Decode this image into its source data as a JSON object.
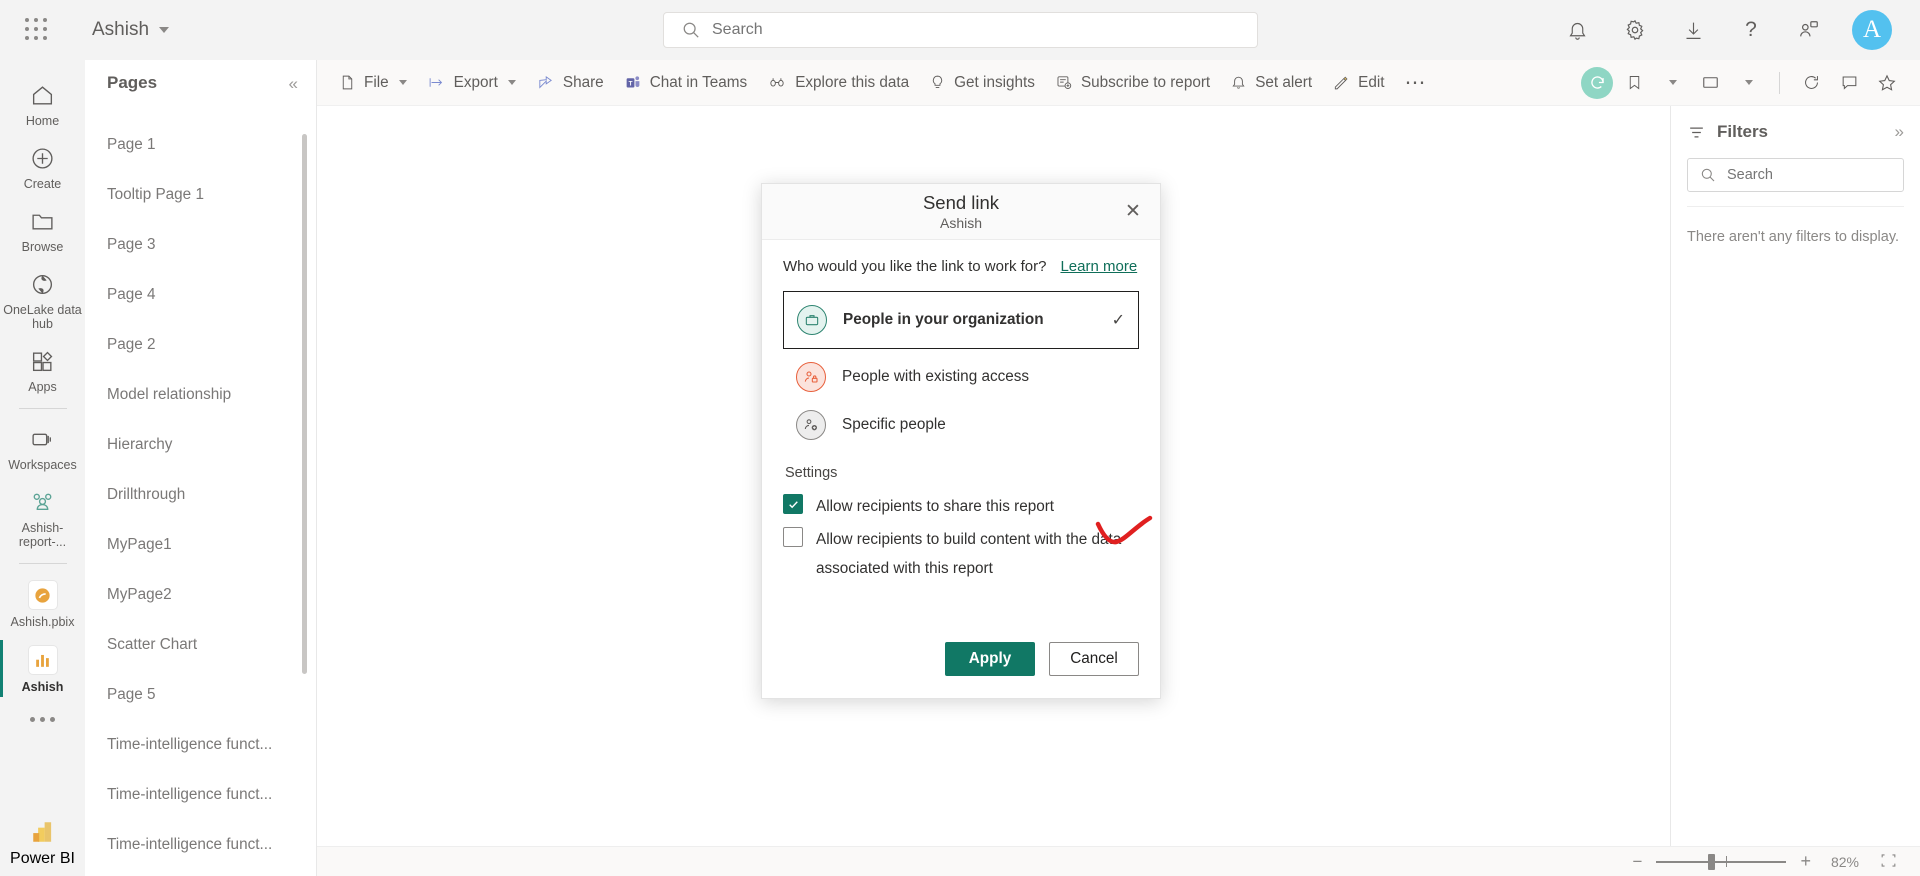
{
  "header": {
    "waffle_icon": "app-launcher-icon",
    "brand": "Ashish",
    "search_placeholder": "Search",
    "search_value": "",
    "icons": [
      "notifications-bell-icon",
      "settings-gear-icon",
      "downloads-icon",
      "help-question-icon",
      "feedback-icon"
    ],
    "avatar_initial": "A"
  },
  "rail": {
    "items": [
      {
        "label": "Home",
        "icon": "home-icon"
      },
      {
        "label": "Create",
        "icon": "plus-circle-icon"
      },
      {
        "label": "Browse",
        "icon": "folder-icon"
      },
      {
        "label": "OneLake data hub",
        "icon": "onelake-icon"
      },
      {
        "label": "Apps",
        "icon": "apps-grid-icon"
      },
      {
        "label": "Workspaces",
        "icon": "workspaces-stack-icon"
      },
      {
        "label": "Ashish-report-...",
        "icon": "people-group-icon"
      },
      {
        "label": "Ashish.pbix",
        "icon": "semantic-model-icon"
      },
      {
        "label": "Ashish",
        "icon": "report-bar-chart-icon",
        "active": true
      }
    ],
    "more_icon": "more-dots-icon",
    "footer_label": "Power BI",
    "footer_icon": "power-bi-logo-icon"
  },
  "pages": {
    "title": "Pages",
    "collapse_icon": "chevron-double-left-icon",
    "items": [
      "Page 1",
      "Tooltip Page 1",
      "Page 3",
      "Page 4",
      "Page 2",
      "Model relationship",
      "Hierarchy",
      "Drillthrough",
      "MyPage1",
      "MyPage2",
      "Scatter Chart",
      "Page 5",
      "Time-intelligence funct...",
      "Time-intelligence funct...",
      "Time-intelligence funct..."
    ]
  },
  "toolbar": {
    "items": [
      {
        "label": "File",
        "icon": "file-icon",
        "caret": true
      },
      {
        "label": "Export",
        "icon": "export-arrow-icon",
        "caret": true
      },
      {
        "label": "Share",
        "icon": "share-icon",
        "caret": false
      },
      {
        "label": "Chat in Teams",
        "icon": "teams-icon",
        "caret": false
      },
      {
        "label": "Explore this data",
        "icon": "explore-glasses-icon",
        "caret": false
      },
      {
        "label": "Get insights",
        "icon": "lightbulb-icon",
        "caret": false
      },
      {
        "label": "Subscribe to report",
        "icon": "subscribe-icon",
        "caret": false
      },
      {
        "label": "Set alert",
        "icon": "bell-alert-icon",
        "caret": false
      },
      {
        "label": "Edit",
        "icon": "pencil-edit-icon",
        "caret": false
      },
      {
        "label": "",
        "icon": "more-ellipsis-icon",
        "caret": false
      }
    ],
    "right_icons": [
      "refresh-circle-icon",
      "bookmark-icon",
      "bookmark-caret-icon",
      "view-fit-icon",
      "view-caret-icon",
      "reset-refresh-icon",
      "comment-icon",
      "favorite-star-icon"
    ]
  },
  "filters": {
    "title": "Filters",
    "filter_icon": "filter-icon",
    "expand_icon": "chevron-double-right-icon",
    "search_placeholder": "Search",
    "search_value": "",
    "empty_message": "There aren't any filters to display."
  },
  "statusbar": {
    "minus": "−",
    "plus": "+",
    "zoom_level": "82%",
    "fit_icon": "fit-to-page-icon"
  },
  "dialog": {
    "title": "Send link",
    "subtitle": "Ashish",
    "close_icon": "close-x-icon",
    "question": "Who would you like the link to work for?",
    "learn_more": "Learn more",
    "audience_options": [
      {
        "label": "People in your organization",
        "icon": "briefcase-icon",
        "selected": true,
        "check_icon": "checkmark-icon"
      },
      {
        "label": "People with existing access",
        "icon": "people-lock-icon",
        "selected": false
      },
      {
        "label": "Specific people",
        "icon": "people-add-icon",
        "selected": false
      }
    ],
    "settings_label": "Settings",
    "settings": [
      {
        "label": "Allow recipients to share this report",
        "checked": true
      },
      {
        "label": "Allow recipients to build content with the data associated with this report",
        "checked": false
      }
    ],
    "apply_label": "Apply",
    "cancel_label": "Cancel",
    "annotation": "red-checkmark-annotation"
  },
  "colors": {
    "accent_green": "#117865",
    "link_green": "#0f6e59",
    "refresh_badge": "#8fd6c4",
    "avatar_blue": "#53c1ef",
    "annotation_red": "#e02020"
  }
}
